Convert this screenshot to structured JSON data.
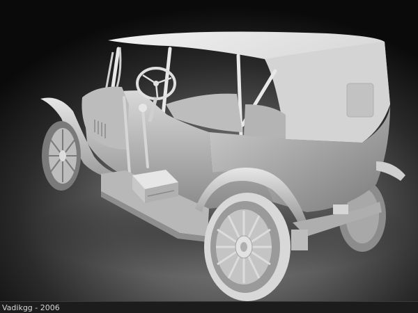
{
  "caption": {
    "text": "Vadikgg - 2006"
  },
  "render": {
    "subject": "vintage-touring-car",
    "palette": {
      "background_dark": "#0a0a0a",
      "background_light": "#8e8e8e",
      "body": "#c9c9c9",
      "highlight": "#efefef",
      "shadow": "#6e6e6e",
      "caption_bar": "#1c1c1c",
      "caption_text": "#d8d8d8"
    }
  }
}
